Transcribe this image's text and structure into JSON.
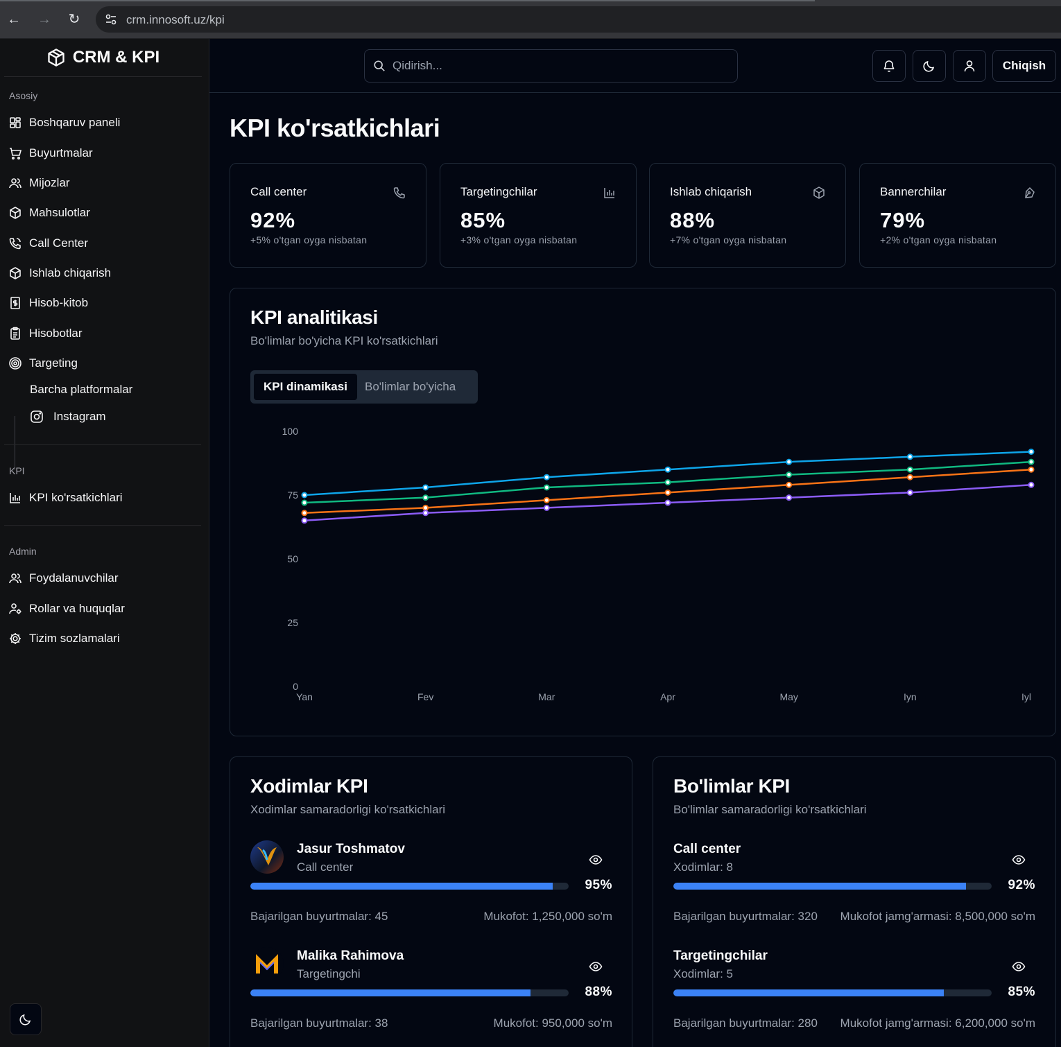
{
  "browser": {
    "url": "crm.innosoft.uz/kpi"
  },
  "brand": {
    "name": "CRM & KPI"
  },
  "sidebar": {
    "sections": [
      "Asosiy",
      "KPI",
      "Admin"
    ],
    "main_items": [
      {
        "label": "Boshqaruv paneli",
        "icon": "dashboard-icon"
      },
      {
        "label": "Buyurtmalar",
        "icon": "cart-icon"
      },
      {
        "label": "Mijozlar",
        "icon": "users-icon"
      },
      {
        "label": "Mahsulotlar",
        "icon": "package-icon"
      },
      {
        "label": "Call Center",
        "icon": "phone-icon"
      },
      {
        "label": "Ishlab chiqarish",
        "icon": "box-icon"
      },
      {
        "label": "Hisob-kitob",
        "icon": "receipt-icon"
      },
      {
        "label": "Hisobotlar",
        "icon": "clipboard-icon"
      },
      {
        "label": "Targeting",
        "icon": "target-icon"
      }
    ],
    "targeting_sub": [
      {
        "label": "Barcha platformalar"
      },
      {
        "label": "Instagram",
        "icon": "instagram-icon"
      }
    ],
    "kpi_items": [
      {
        "label": "KPI ko'rsatkichlari",
        "icon": "bar-chart-icon"
      }
    ],
    "admin_items": [
      {
        "label": "Foydalanuvchilar",
        "icon": "users-icon"
      },
      {
        "label": "Rollar va huquqlar",
        "icon": "user-cog-icon"
      },
      {
        "label": "Tizim sozlamalari",
        "icon": "settings-icon"
      }
    ]
  },
  "header": {
    "search_placeholder": "Qidirish...",
    "logout_label": "Chiqish"
  },
  "page": {
    "title": "KPI ko'rsatkichlari"
  },
  "stats": [
    {
      "label": "Call center",
      "value": "92%",
      "delta": "+5% o'tgan oyga nisbatan",
      "icon": "phone-icon"
    },
    {
      "label": "Targetingchilar",
      "value": "85%",
      "delta": "+3% o'tgan oyga nisbatan",
      "icon": "bar-chart-icon"
    },
    {
      "label": "Ishlab chiqarish",
      "value": "88%",
      "delta": "+7% o'tgan oyga nisbatan",
      "icon": "box-icon"
    },
    {
      "label": "Bannerchilar",
      "value": "79%",
      "delta": "+2% o'tgan oyga nisbatan",
      "icon": "pen-tool-icon"
    }
  ],
  "analytics": {
    "title": "KPI analitikasi",
    "subtitle": "Bo'limlar bo'yicha KPI ko'rsatkichlari",
    "tabs": [
      "KPI dinamikasi",
      "Bo'limlar bo'yicha"
    ]
  },
  "chart_data": {
    "type": "line",
    "categories": [
      "Yan",
      "Fev",
      "Mar",
      "Apr",
      "May",
      "Iyl"
    ],
    "x_labels": [
      "Yan",
      "Fev",
      "Mar",
      "Apr",
      "May",
      "Iyn",
      "Iyl"
    ],
    "yticks": [
      0,
      25,
      50,
      75,
      100
    ],
    "ylim": [
      0,
      100
    ],
    "grid": false,
    "legend": "none",
    "series": [
      {
        "color": "#0ea5e9",
        "values": [
          75,
          78,
          82,
          85,
          88,
          90,
          92
        ]
      },
      {
        "color": "#10b981",
        "values": [
          72,
          74,
          78,
          80,
          83,
          85,
          88
        ]
      },
      {
        "color": "#f97316",
        "values": [
          68,
          70,
          73,
          76,
          79,
          82,
          85
        ]
      },
      {
        "color": "#8b5cf6",
        "values": [
          65,
          68,
          70,
          72,
          74,
          76,
          79
        ]
      }
    ]
  },
  "employees": {
    "title": "Xodimlar KPI",
    "subtitle": "Xodimlar samaradorligi ko'rsatkichlari",
    "items": [
      {
        "name": "Jasur Toshmatov",
        "role": "Call center",
        "progress": 95,
        "pct_label": "95%",
        "orders": "Bajarilgan buyurtmalar: 45",
        "bonus": "Mukofot: 1,250,000 so'm"
      },
      {
        "name": "Malika Rahimova",
        "role": "Targetingchi",
        "progress": 88,
        "pct_label": "88%",
        "orders": "Bajarilgan buyurtmalar: 38",
        "bonus": "Mukofot: 950,000 so'm"
      }
    ]
  },
  "departments": {
    "title": "Bo'limlar KPI",
    "subtitle": "Bo'limlar samaradorligi ko'rsatkichlari",
    "items": [
      {
        "name": "Call center",
        "role": "Xodimlar: 8",
        "progress": 92,
        "pct_label": "92%",
        "orders": "Bajarilgan buyurtmalar: 320",
        "bonus": "Mukofot jamg'armasi: 8,500,000 so'm"
      },
      {
        "name": "Targetingchilar",
        "role": "Xodimlar: 5",
        "progress": 85,
        "pct_label": "85%",
        "orders": "Bajarilgan buyurtmalar: 280",
        "bonus": "Mukofot jamg'armasi: 6,200,000 so'm"
      }
    ]
  },
  "colors": {
    "accent": "#3b82f6",
    "background": "#030712",
    "sidebar": "#111214"
  }
}
